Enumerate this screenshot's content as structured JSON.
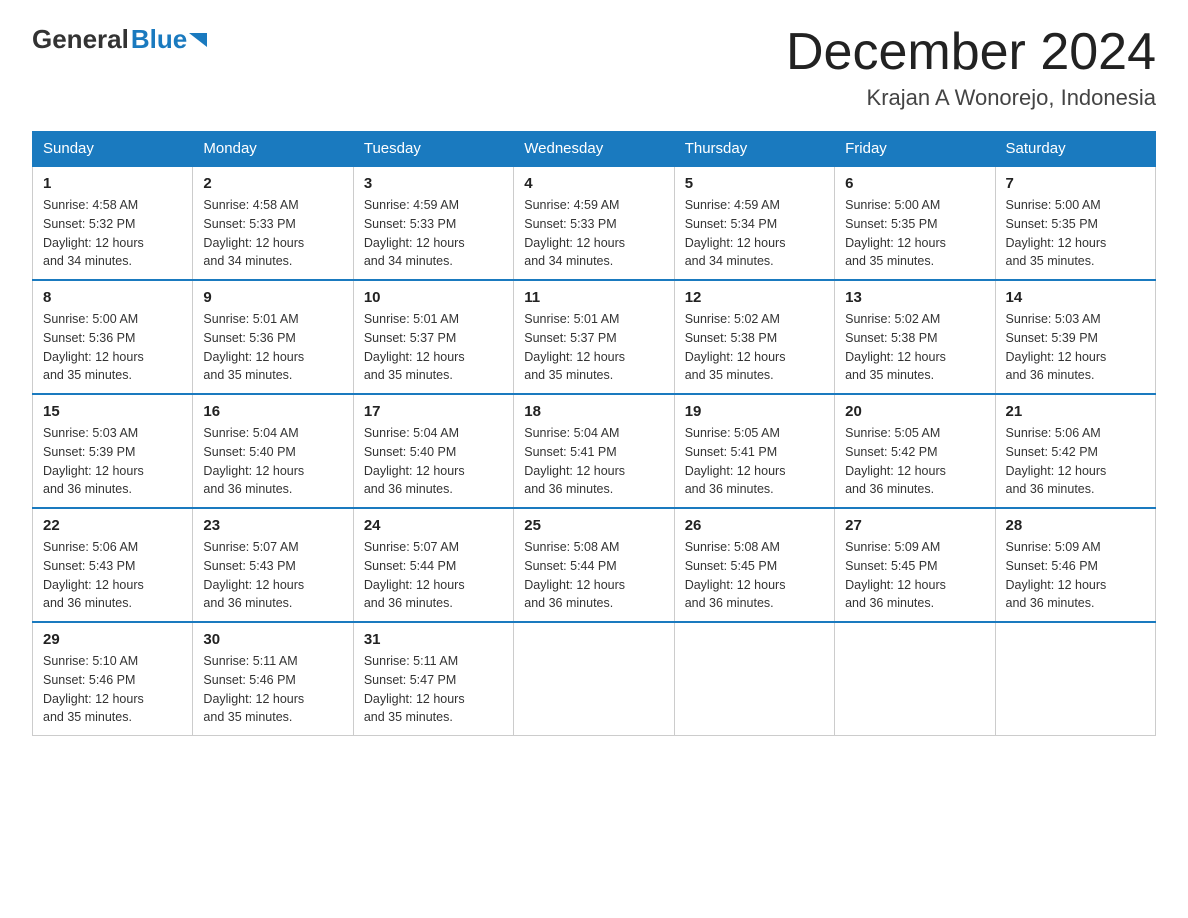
{
  "logo": {
    "general": "General",
    "blue": "Blue"
  },
  "title": "December 2024",
  "subtitle": "Krajan A Wonorejo, Indonesia",
  "days": [
    "Sunday",
    "Monday",
    "Tuesday",
    "Wednesday",
    "Thursday",
    "Friday",
    "Saturday"
  ],
  "weeks": [
    [
      {
        "num": "1",
        "sunrise": "4:58 AM",
        "sunset": "5:32 PM",
        "daylight": "12 hours and 34 minutes."
      },
      {
        "num": "2",
        "sunrise": "4:58 AM",
        "sunset": "5:33 PM",
        "daylight": "12 hours and 34 minutes."
      },
      {
        "num": "3",
        "sunrise": "4:59 AM",
        "sunset": "5:33 PM",
        "daylight": "12 hours and 34 minutes."
      },
      {
        "num": "4",
        "sunrise": "4:59 AM",
        "sunset": "5:33 PM",
        "daylight": "12 hours and 34 minutes."
      },
      {
        "num": "5",
        "sunrise": "4:59 AM",
        "sunset": "5:34 PM",
        "daylight": "12 hours and 34 minutes."
      },
      {
        "num": "6",
        "sunrise": "5:00 AM",
        "sunset": "5:35 PM",
        "daylight": "12 hours and 35 minutes."
      },
      {
        "num": "7",
        "sunrise": "5:00 AM",
        "sunset": "5:35 PM",
        "daylight": "12 hours and 35 minutes."
      }
    ],
    [
      {
        "num": "8",
        "sunrise": "5:00 AM",
        "sunset": "5:36 PM",
        "daylight": "12 hours and 35 minutes."
      },
      {
        "num": "9",
        "sunrise": "5:01 AM",
        "sunset": "5:36 PM",
        "daylight": "12 hours and 35 minutes."
      },
      {
        "num": "10",
        "sunrise": "5:01 AM",
        "sunset": "5:37 PM",
        "daylight": "12 hours and 35 minutes."
      },
      {
        "num": "11",
        "sunrise": "5:01 AM",
        "sunset": "5:37 PM",
        "daylight": "12 hours and 35 minutes."
      },
      {
        "num": "12",
        "sunrise": "5:02 AM",
        "sunset": "5:38 PM",
        "daylight": "12 hours and 35 minutes."
      },
      {
        "num": "13",
        "sunrise": "5:02 AM",
        "sunset": "5:38 PM",
        "daylight": "12 hours and 35 minutes."
      },
      {
        "num": "14",
        "sunrise": "5:03 AM",
        "sunset": "5:39 PM",
        "daylight": "12 hours and 36 minutes."
      }
    ],
    [
      {
        "num": "15",
        "sunrise": "5:03 AM",
        "sunset": "5:39 PM",
        "daylight": "12 hours and 36 minutes."
      },
      {
        "num": "16",
        "sunrise": "5:04 AM",
        "sunset": "5:40 PM",
        "daylight": "12 hours and 36 minutes."
      },
      {
        "num": "17",
        "sunrise": "5:04 AM",
        "sunset": "5:40 PM",
        "daylight": "12 hours and 36 minutes."
      },
      {
        "num": "18",
        "sunrise": "5:04 AM",
        "sunset": "5:41 PM",
        "daylight": "12 hours and 36 minutes."
      },
      {
        "num": "19",
        "sunrise": "5:05 AM",
        "sunset": "5:41 PM",
        "daylight": "12 hours and 36 minutes."
      },
      {
        "num": "20",
        "sunrise": "5:05 AM",
        "sunset": "5:42 PM",
        "daylight": "12 hours and 36 minutes."
      },
      {
        "num": "21",
        "sunrise": "5:06 AM",
        "sunset": "5:42 PM",
        "daylight": "12 hours and 36 minutes."
      }
    ],
    [
      {
        "num": "22",
        "sunrise": "5:06 AM",
        "sunset": "5:43 PM",
        "daylight": "12 hours and 36 minutes."
      },
      {
        "num": "23",
        "sunrise": "5:07 AM",
        "sunset": "5:43 PM",
        "daylight": "12 hours and 36 minutes."
      },
      {
        "num": "24",
        "sunrise": "5:07 AM",
        "sunset": "5:44 PM",
        "daylight": "12 hours and 36 minutes."
      },
      {
        "num": "25",
        "sunrise": "5:08 AM",
        "sunset": "5:44 PM",
        "daylight": "12 hours and 36 minutes."
      },
      {
        "num": "26",
        "sunrise": "5:08 AM",
        "sunset": "5:45 PM",
        "daylight": "12 hours and 36 minutes."
      },
      {
        "num": "27",
        "sunrise": "5:09 AM",
        "sunset": "5:45 PM",
        "daylight": "12 hours and 36 minutes."
      },
      {
        "num": "28",
        "sunrise": "5:09 AM",
        "sunset": "5:46 PM",
        "daylight": "12 hours and 36 minutes."
      }
    ],
    [
      {
        "num": "29",
        "sunrise": "5:10 AM",
        "sunset": "5:46 PM",
        "daylight": "12 hours and 35 minutes."
      },
      {
        "num": "30",
        "sunrise": "5:11 AM",
        "sunset": "5:46 PM",
        "daylight": "12 hours and 35 minutes."
      },
      {
        "num": "31",
        "sunrise": "5:11 AM",
        "sunset": "5:47 PM",
        "daylight": "12 hours and 35 minutes."
      },
      null,
      null,
      null,
      null
    ]
  ]
}
